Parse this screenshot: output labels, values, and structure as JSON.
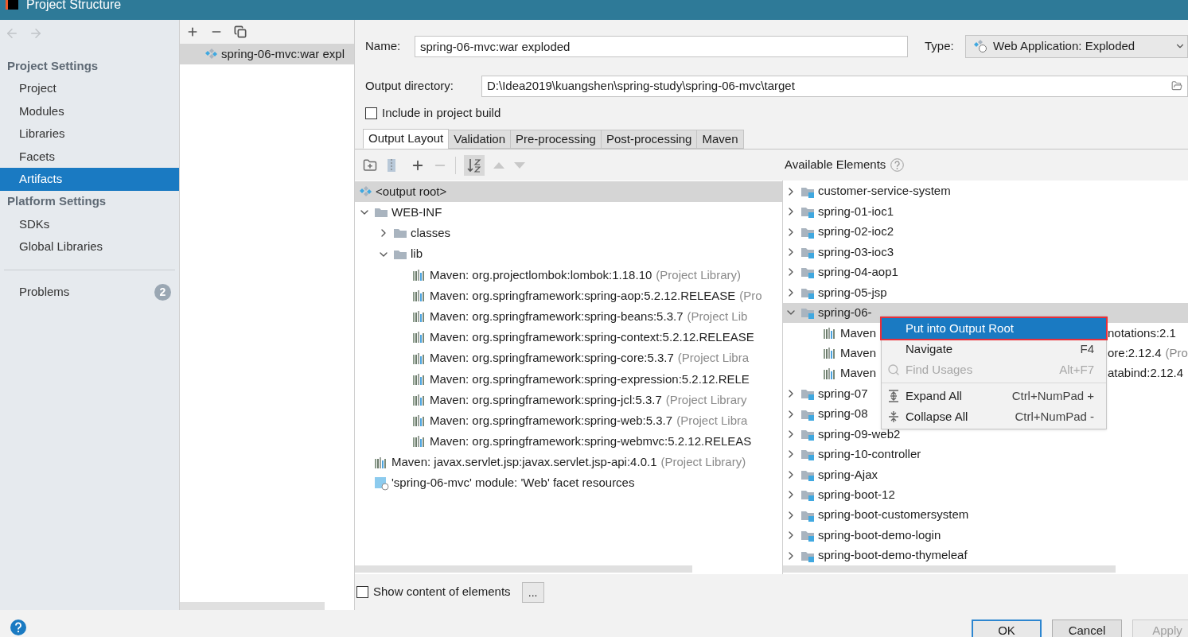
{
  "window": {
    "title": "Project Structure"
  },
  "sidebar": {
    "sections": [
      {
        "heading": "Project Settings",
        "items": [
          {
            "label": "Project",
            "selected": false
          },
          {
            "label": "Modules",
            "selected": false
          },
          {
            "label": "Libraries",
            "selected": false
          },
          {
            "label": "Facets",
            "selected": false
          },
          {
            "label": "Artifacts",
            "selected": true
          }
        ]
      },
      {
        "heading": "Platform Settings",
        "items": [
          {
            "label": "SDKs",
            "selected": false
          },
          {
            "label": "Global Libraries",
            "selected": false
          }
        ]
      }
    ],
    "problems": {
      "label": "Problems",
      "count": "2"
    }
  },
  "artifacts": [
    {
      "label": "spring-06-mvc:war expl",
      "selected": true
    }
  ],
  "form": {
    "name_label": "Name:",
    "name_value": "spring-06-mvc:war exploded",
    "type_label": "Type:",
    "type_value": "Web Application: Exploded",
    "output_label": "Output directory:",
    "output_value": "D:\\Idea2019\\kuangshen\\spring-study\\spring-06-mvc\\target",
    "include": {
      "label": "Include in project build",
      "checked": false
    }
  },
  "tabs": [
    {
      "label": "Output Layout",
      "selected": true
    },
    {
      "label": "Validation",
      "selected": false
    },
    {
      "label": "Pre-processing",
      "selected": false
    },
    {
      "label": "Post-processing",
      "selected": false
    },
    {
      "label": "Maven",
      "selected": false
    }
  ],
  "layout_tree": [
    {
      "label": "<output root>",
      "kind": "root",
      "selected": true
    },
    {
      "label": "WEB-INF",
      "kind": "folder",
      "expanded": true,
      "selected": false,
      "children": [
        {
          "label": "classes",
          "kind": "folder",
          "expanded": false,
          "selected": false
        },
        {
          "label": "lib",
          "kind": "folder",
          "expanded": true,
          "selected": false,
          "children": [
            {
              "label": "Maven: org.projectlombok:lombok:1.18.10",
              "note": "(Project Library)",
              "kind": "library",
              "selected": false
            },
            {
              "label": "Maven: org.springframework:spring-aop:5.2.12.RELEASE",
              "note": "(Pro",
              "kind": "library",
              "selected": false
            },
            {
              "label": "Maven: org.springframework:spring-beans:5.3.7",
              "note": "(Project Lib",
              "kind": "library",
              "selected": false
            },
            {
              "label": "Maven: org.springframework:spring-context:5.2.12.RELEASE",
              "kind": "library",
              "selected": false
            },
            {
              "label": "Maven: org.springframework:spring-core:5.3.7",
              "note": "(Project Libra",
              "kind": "library",
              "selected": false
            },
            {
              "label": "Maven: org.springframework:spring-expression:5.2.12.RELE",
              "kind": "library",
              "selected": false
            },
            {
              "label": "Maven: org.springframework:spring-jcl:5.3.7",
              "note": "(Project Library",
              "kind": "library",
              "selected": false
            },
            {
              "label": "Maven: org.springframework:spring-web:5.3.7",
              "note": "(Project Libra",
              "kind": "library",
              "selected": false
            },
            {
              "label": "Maven: org.springframework:spring-webmvc:5.2.12.RELEAS",
              "kind": "library",
              "selected": false
            }
          ]
        }
      ]
    },
    {
      "label": "Maven: javax.servlet.jsp:javax.servlet.jsp-api:4.0.1",
      "note": "(Project Library)",
      "kind": "library",
      "selected": false
    },
    {
      "label": "'spring-06-mvc' module: 'Web' facet resources",
      "kind": "facet",
      "selected": false
    }
  ],
  "available": {
    "title": "Available Elements",
    "items": [
      {
        "label": "customer-service-system",
        "expanded": false,
        "selected": false
      },
      {
        "label": "spring-01-ioc1",
        "expanded": false,
        "selected": false
      },
      {
        "label": "spring-02-ioc2",
        "expanded": false,
        "selected": false
      },
      {
        "label": "spring-03-ioc3",
        "expanded": false,
        "selected": false
      },
      {
        "label": "spring-04-aop1",
        "expanded": false,
        "selected": false
      },
      {
        "label": "spring-05-jsp",
        "expanded": false,
        "selected": false
      },
      {
        "label": "spring-06-",
        "expanded": true,
        "selected": true,
        "children": [
          {
            "label": "Maven",
            "tail": "notations:2.1"
          },
          {
            "label": "Maven",
            "tail": "ore:2.12.4",
            "note": "(Pro"
          },
          {
            "label": "Maven",
            "tail": "atabind:2.12.4"
          }
        ]
      },
      {
        "label": "spring-07",
        "expanded": false,
        "selected": false
      },
      {
        "label": "spring-08",
        "expanded": false,
        "selected": false
      },
      {
        "label": "spring-09-web2",
        "expanded": false,
        "selected": false
      },
      {
        "label": "spring-10-controller",
        "expanded": false,
        "selected": false
      },
      {
        "label": "spring-Ajax",
        "expanded": false,
        "selected": false
      },
      {
        "label": "spring-boot-12",
        "expanded": false,
        "selected": false
      },
      {
        "label": "spring-boot-customersystem",
        "expanded": false,
        "selected": false
      },
      {
        "label": "spring-boot-demo-login",
        "expanded": false,
        "selected": false
      },
      {
        "label": "spring-boot-demo-thymeleaf",
        "expanded": false,
        "selected": false
      }
    ]
  },
  "context_menu": [
    {
      "label": "Put into Output Root",
      "kind": "plain",
      "selected": true,
      "disabled": false
    },
    {
      "label": "Navigate",
      "shortcut": "F4",
      "kind": "plain",
      "selected": false,
      "disabled": false
    },
    {
      "label": "Find Usages",
      "shortcut": "Alt+F7",
      "kind": "search",
      "selected": false,
      "disabled": true
    },
    {
      "label": "Expand All",
      "shortcut": "Ctrl+NumPad +",
      "kind": "expand",
      "selected": false,
      "disabled": false
    },
    {
      "label": "Collapse All",
      "shortcut": "Ctrl+NumPad -",
      "kind": "collapse",
      "selected": false,
      "disabled": false
    }
  ],
  "show_content": {
    "label": "Show content of elements",
    "checked": false
  },
  "more_button": "...",
  "buttons": [
    {
      "label": "OK",
      "kind": "primary"
    },
    {
      "label": "Cancel",
      "kind": "secondary"
    },
    {
      "label": "Apply",
      "kind": "disabled"
    }
  ]
}
